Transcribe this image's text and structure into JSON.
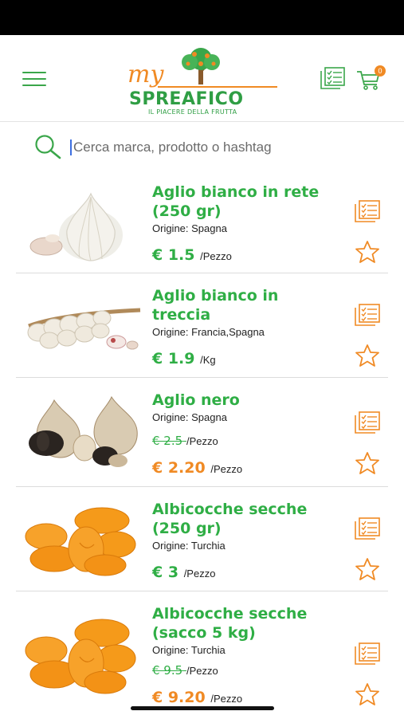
{
  "header": {
    "logo_my": "my",
    "logo_brand": "SPREAFICO",
    "logo_tagline": "IL PIACERE DELLA FRUTTA",
    "cart_count": "0"
  },
  "search": {
    "placeholder": "Cerca marca, prodotto o hashtag"
  },
  "colors": {
    "brand_green": "#2fae45",
    "accent_orange": "#f08a24"
  },
  "products": [
    {
      "name_line1": "Aglio bianco in rete",
      "name_line2": "(250 gr)",
      "origin": "Origine: Spagna",
      "price": "€ 1.5",
      "unit": "/Pezzo",
      "image": "garlic-bulb"
    },
    {
      "name_line1": "Aglio bianco in",
      "name_line2": "treccia",
      "origin": "Origine: Francia,Spagna",
      "price": "€ 1.9",
      "unit": "/Kg",
      "image": "garlic-braid"
    },
    {
      "name_line1": "Aglio nero",
      "origin": "Origine: Spagna",
      "old_price": "€ 2.5",
      "old_unit": "/Pezzo",
      "price": "€ 2.20",
      "unit": "/Pezzo",
      "image": "black-garlic"
    },
    {
      "name_line1": "Albicocche secche",
      "name_line2": "(250 gr)",
      "origin": "Origine: Turchia",
      "price": "€ 3",
      "unit": "/Pezzo",
      "image": "dried-apricots"
    },
    {
      "name_line1": "Albicocche secche",
      "name_line2": "(sacco 5 kg)",
      "origin": "Origine: Turchia",
      "old_price": "€ 9.5",
      "old_unit": "/Pezzo",
      "price": "€ 9.20",
      "unit": "/Pezzo",
      "image": "dried-apricots"
    }
  ]
}
